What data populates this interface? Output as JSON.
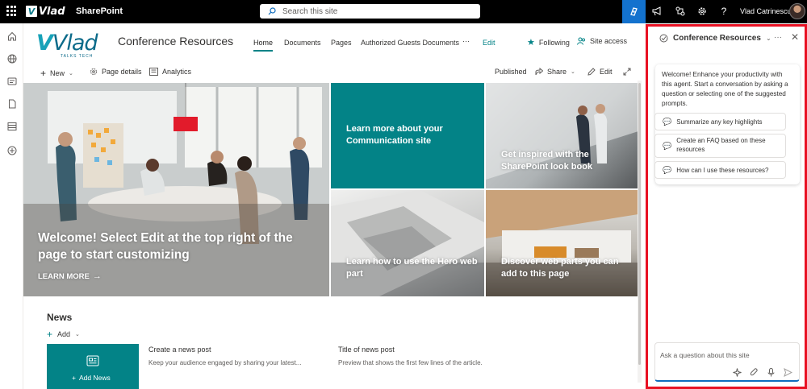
{
  "topbar": {
    "logo_text": "Vlad",
    "app_name": "SharePoint",
    "search_placeholder": "Search this site",
    "user_name": "Vlad Catrinescu"
  },
  "site": {
    "logo_text": "Vlad",
    "logo_tagline": "TALKS TECH",
    "title": "Conference Resources",
    "nav": [
      "Home",
      "Documents",
      "Pages",
      "Authorized Guests Documents",
      "···",
      "Edit"
    ],
    "following_label": "Following",
    "site_access_label": "Site access"
  },
  "commandbar": {
    "new_label": "New",
    "page_details_label": "Page details",
    "analytics_label": "Analytics",
    "status": "Published",
    "share_label": "Share",
    "edit_label": "Edit"
  },
  "hero": {
    "main_title": "Welcome! Select Edit at the top right of the page to start customizing",
    "main_link": "LEARN MORE",
    "tiles": [
      "Learn more about your Communication site",
      "Get inspired with the SharePoint look book",
      "Learn how to use the Hero web part",
      "Discover web parts you can add to this page"
    ]
  },
  "news": {
    "title": "News",
    "add_label": "Add",
    "card_label": "Add News",
    "posts": [
      {
        "title": "Create a news post",
        "desc": "Keep your audience engaged by sharing your latest..."
      },
      {
        "title": "Title of news post",
        "desc": "Preview that shows the first few lines of the article."
      }
    ]
  },
  "copilot": {
    "title": "Conference Resources",
    "welcome": "Welcome! Enhance your productivity with this agent. Start a conversation by asking a question or selecting one of the suggested prompts.",
    "suggestions": [
      "Summarize any key highlights",
      "Create an FAQ based on these resources",
      "How can I use these resources?"
    ],
    "input_placeholder": "Ask a question about this site"
  },
  "colors": {
    "accent": "#038387",
    "copilot_button": "#1372ce",
    "panel_border": "#e81123"
  }
}
